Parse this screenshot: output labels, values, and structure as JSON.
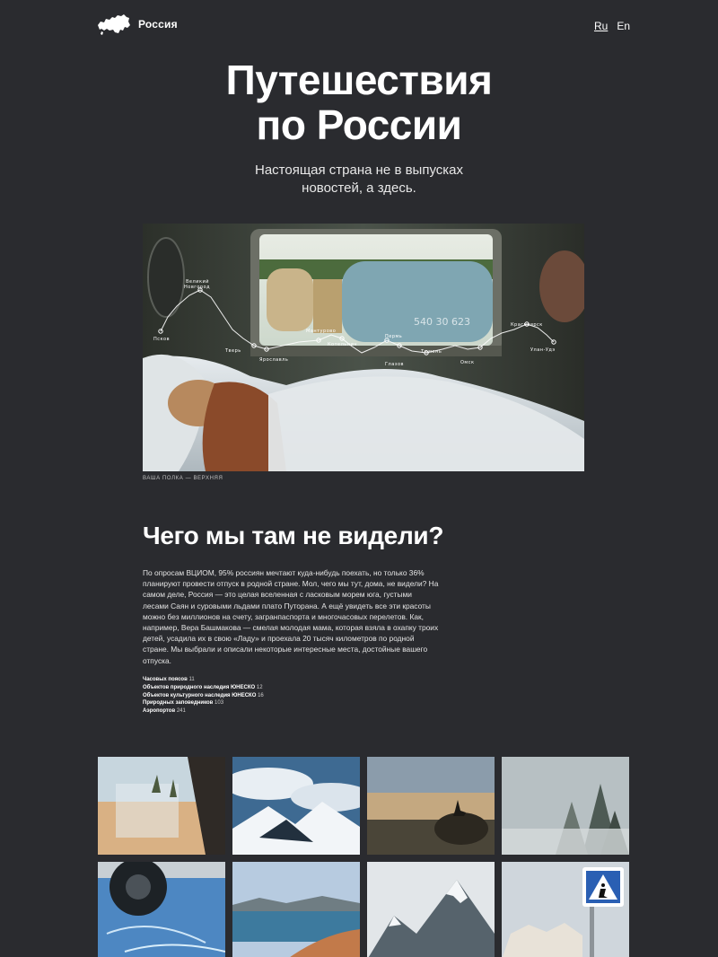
{
  "header": {
    "logo_text": "Россия",
    "lang_ru": "Ru",
    "lang_en": "En"
  },
  "hero": {
    "title_line1": "Путешествия",
    "title_line2": "по России",
    "subtitle_line1": "Настоящая страна не в выпусках",
    "subtitle_line2": "новостей, а здесь."
  },
  "route_map": {
    "cities": {
      "pskov": "Псков",
      "novgorod_1": "Великий",
      "novgorod_2": "Новгород",
      "tver": "Тверь",
      "yaroslavl": "Ярославль",
      "kotelnich": "Котельнич",
      "mantur": "Мантурово",
      "perm": "Пермь",
      "glazov": "Глазов",
      "tyumen": "Тюмень",
      "omsk": "Омск",
      "krasnoyarsk": "Красноярск",
      "ulan_ude": "Улан-Удэ"
    },
    "train_number": "540 30 623"
  },
  "caption": "Ваша полка — верхняя",
  "section": {
    "title": "Чего мы там не видели?",
    "body": "По опросам ВЦИОМ, 95% россиян мечтают куда-нибудь поехать, но только 36% планируют провести отпуск в родной стране. Мол, чего мы тут, дома, не видели? На самом деле, Россия — это целая вселенная с ласковым морем юга, густыми лесами Саян и суровыми льдами плато Путорана. А ещё увидеть все эти красоты можно без миллионов на счету, загранпаспорта и многочасовых перелетов. Как, например, Вера Башмакова — смелая молодая мама, которая взяла в охапку троих детей, усадила их в свою «Ладу» и проехала 20 тысяч километров по родной стране. Мы выбрали и описали некоторые интересные места, достойные вашего отпуска."
  },
  "stats": [
    {
      "label": "Часовых поясов",
      "value": "11"
    },
    {
      "label": "Объектов природного наследия ЮНЕСКО",
      "value": "12"
    },
    {
      "label": "Объектов культурного наследия ЮНЕСКО",
      "value": "16"
    },
    {
      "label": "Природных заповедников",
      "value": "103"
    },
    {
      "label": "Аэропортов",
      "value": "241"
    }
  ],
  "colors": {
    "background": "#2a2b2f",
    "text": "#ffffff"
  },
  "icons": {
    "logo": "russia-map-icon",
    "road_sign": "pedestrian-crossing-sign-icon"
  }
}
